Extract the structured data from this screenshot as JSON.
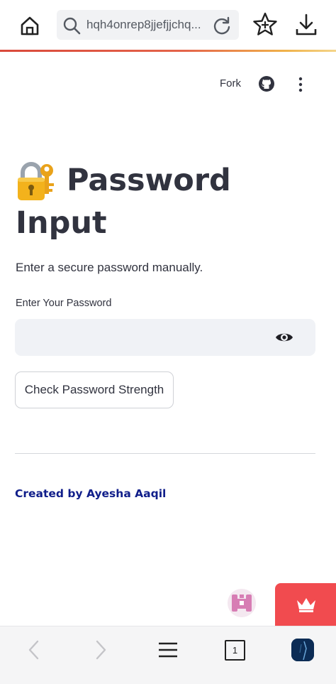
{
  "browser": {
    "url": "hqh4onrep8jjefjjchq...",
    "icons": [
      "home-icon",
      "search-icon",
      "reload-icon",
      "star-add-icon",
      "download-icon"
    ],
    "progress_colors": [
      "#d9493b",
      "#f0b24a"
    ]
  },
  "app_header": {
    "fork_label": "Fork",
    "icons": [
      "github-icon",
      "more-vertical-icon"
    ]
  },
  "main": {
    "title_emoji": "🔐",
    "title_line1": "Password",
    "title_line2": "Input",
    "subtitle": "Enter a secure password manually.",
    "password_label": "Enter Your Password",
    "password_value": "",
    "check_button_label": "Check Password Strength",
    "credit": "Created by Ayesha Aaqil"
  },
  "floating": {
    "bot_icon": "bot-badge-icon",
    "crown_icon": "crown-icon"
  },
  "bottom_nav": {
    "tab_count": "1",
    "icons": [
      "back-icon",
      "forward-icon",
      "menu-icon",
      "tabs-icon",
      "profile-avatar"
    ]
  },
  "colors": {
    "text": "#31333f",
    "credit": "#101e8a",
    "input_bg": "#f0f2f6",
    "crown_tab": "#f14b4f"
  }
}
